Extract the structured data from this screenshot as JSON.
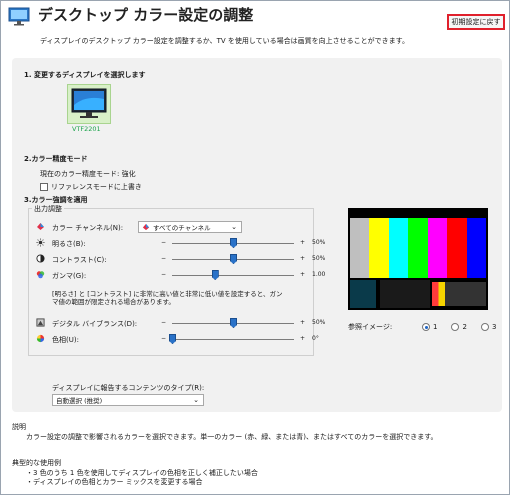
{
  "window": {
    "title": "デスクトップ カラー設定の調整",
    "reset_button": "初期設定に戻す",
    "intro": "ディスプレイのデスクトップ カラー設定を調整するか、TV を使用している場合は画質を向上させることができます。"
  },
  "section1": {
    "heading": "1. 変更するディスプレイを選択します",
    "display_name": "VTF2201"
  },
  "section2": {
    "heading": "2.カラー精度モード",
    "current_mode": "現在のカラー精度モード: 強化",
    "checkbox_label": "リファレンスモードに上書き",
    "checkbox_checked": false
  },
  "section3": {
    "heading": "3.カラー強調を適用",
    "group_title": "出力調整",
    "channel_label": "カラー チャンネル(N):",
    "channel_value": "すべてのチャンネル",
    "sliders": [
      {
        "label": "明るさ(B):",
        "value": "50%",
        "icon": "brightness-icon",
        "position": 0.5
      },
      {
        "label": "コントラスト(C):",
        "value": "50%",
        "icon": "contrast-icon",
        "position": 0.5
      },
      {
        "label": "ガンマ(G):",
        "value": "1.00",
        "icon": "gamma-icon",
        "position": 0.35
      }
    ],
    "warning_line1": "[明るさ] と [コントラスト] に非常に高い値と非常に低い値を設定すると、ガン",
    "warning_line2": "マ値の範囲が限定される場合があります。",
    "sliders2": [
      {
        "label": "デジタル バイブランス(D):",
        "value": "50%",
        "icon": "vibrance-icon",
        "position": 0.5
      },
      {
        "label": "色相(U):",
        "value": "0°",
        "icon": "hue-icon",
        "position": 0.0
      }
    ],
    "minus": "−",
    "plus": "+",
    "content_type_label": "ディスプレイに報告するコンテンツのタイプ(R):",
    "content_type_value": "自動選択 (推奨)"
  },
  "reference": {
    "label": "参照イメージ:",
    "options": [
      "1",
      "2",
      "3"
    ],
    "selected": "1",
    "bar_colors": [
      "#bfbfbf",
      "#ffff00",
      "#00ffff",
      "#00ff00",
      "#ff00ff",
      "#ff0000",
      "#0000ff"
    ]
  },
  "description": {
    "heading": "説明",
    "text": "カラー設定の調整で影響されるカラーを選択できます。単一のカラー (赤、緑、または青)、またはすべてのカラーを選択できます。"
  },
  "usage": {
    "heading": "典型的な使用例",
    "items": [
      "・3 色のうち 1 色を使用してディスプレイの色相を正しく補正したい場合",
      "・ディスプレイの色相とカラー ミックスを変更する場合"
    ]
  }
}
